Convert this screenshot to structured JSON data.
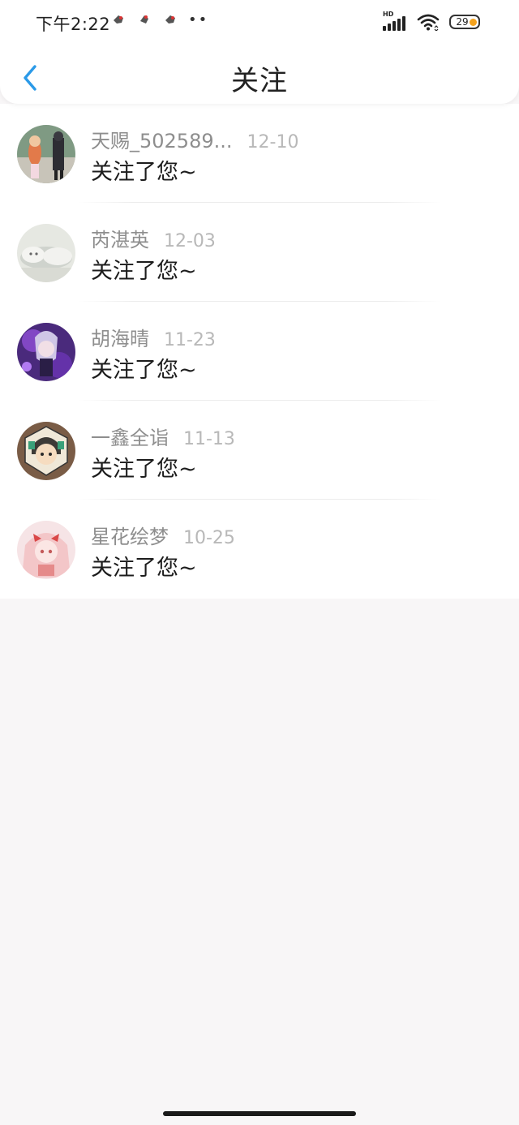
{
  "status_bar": {
    "time": "下午2:22",
    "dots": "••",
    "hd_label": "HD",
    "battery": "29",
    "colors": {
      "battery_dot": "#f4a21d"
    },
    "icons": [
      "notification-icon",
      "notification-icon",
      "notification-icon",
      "signal-icon",
      "wifi-icon",
      "battery-icon"
    ]
  },
  "nav": {
    "title": "关注",
    "back_icon": "chevron-left-icon",
    "accent": "#2b9ae8"
  },
  "followers": [
    {
      "name": "天赐_502589...",
      "date": "12-10",
      "message": "关注了您~"
    },
    {
      "name": "芮湛英",
      "date": "12-03",
      "message": "关注了您~"
    },
    {
      "name": "胡海晴",
      "date": "11-23",
      "message": "关注了您~"
    },
    {
      "name": "一鑫全诣",
      "date": "11-13",
      "message": "关注了您~"
    },
    {
      "name": "星花绘梦",
      "date": "10-25",
      "message": "关注了您~"
    }
  ]
}
